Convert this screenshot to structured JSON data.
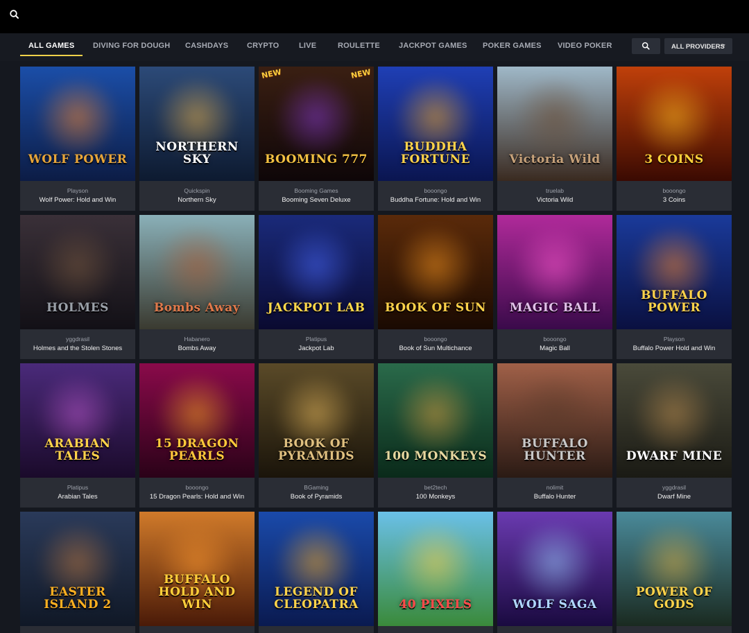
{
  "nav": {
    "tabs": [
      {
        "label": "ALL GAMES"
      },
      {
        "label": "DIVING FOR DOUGH"
      },
      {
        "label": "CASHDAYS"
      },
      {
        "label": "CRYPTO"
      },
      {
        "label": "LIVE"
      },
      {
        "label": "ROULETTE"
      },
      {
        "label": "JACKPOT GAMES"
      },
      {
        "label": "POKER GAMES"
      },
      {
        "label": "VIDEO POKER"
      }
    ],
    "active_tab": "ALL GAMES",
    "providers_label": "ALL PROVIDERS"
  },
  "colors": {
    "accent": "#f0d24a",
    "card_bg": "#2a2d35",
    "page_bg": "#15181f"
  },
  "games": [
    {
      "provider": "Playson",
      "name": "Wolf Power: Hold and Win",
      "art": "WOLF POWER",
      "art_color": "#e8a63a",
      "bg": [
        "#1b4ea8",
        "#0c1c45"
      ],
      "glow": "#ff8a2a"
    },
    {
      "provider": "Quickspin",
      "name": "Northern Sky",
      "art": "NORTHERN SKY",
      "art_color": "#ffffff",
      "bg": [
        "#2c4a78",
        "#0d1a30"
      ],
      "glow": "#f0b64a"
    },
    {
      "provider": "Booming Games",
      "name": "Booming Seven Deluxe",
      "art": "BOOMING 777",
      "art_color": "#f5c242",
      "bg": [
        "#3a1f12",
        "#0e0608"
      ],
      "glow": "#8a3cd8",
      "new": "NEW"
    },
    {
      "provider": "booongo",
      "name": "Buddha Fortune: Hold and Win",
      "art": "BUDDHA FORTUNE",
      "art_color": "#ffd34a",
      "bg": [
        "#1f3fb5",
        "#0a1550"
      ],
      "glow": "#ffb020"
    },
    {
      "provider": "truelab",
      "name": "Victoria Wild",
      "art": "Victoria Wild",
      "art_color": "#c7a27a",
      "bg": [
        "#9fb8c8",
        "#3a2a20"
      ],
      "glow": "#6a4a30"
    },
    {
      "provider": "booongo",
      "name": "3 Coins",
      "art": "3 COINS",
      "art_color": "#ffd23a",
      "bg": [
        "#c0400a",
        "#3a0a02"
      ],
      "glow": "#ffc020"
    },
    {
      "provider": "yggdrasil",
      "name": "Holmes and the Stolen Stones",
      "art": "HOLMES",
      "art_color": "#9aa0a8",
      "bg": [
        "#3a3038",
        "#121016"
      ],
      "glow": "#7a5a40"
    },
    {
      "provider": "Habanero",
      "name": "Bombs Away",
      "art": "Bombs Away",
      "art_color": "#e0784a",
      "bg": [
        "#8ab0b8",
        "#3a3a30"
      ],
      "glow": "#b05a30"
    },
    {
      "provider": "Platipus",
      "name": "Jackpot Lab",
      "art": "JACKPOT LAB",
      "art_color": "#ffd94a",
      "bg": [
        "#1a2a7a",
        "#0a0a30"
      ],
      "glow": "#4a6aff"
    },
    {
      "provider": "booongo",
      "name": "Book of Sun Multichance",
      "art": "BOOK OF SUN",
      "art_color": "#ffd34a",
      "bg": [
        "#5a2a0a",
        "#1a0a02"
      ],
      "glow": "#ff9a20"
    },
    {
      "provider": "booongo",
      "name": "Magic Ball",
      "art": "MAGIC BALL",
      "art_color": "#e0c0e8",
      "bg": [
        "#b02a9a",
        "#3a0a4a"
      ],
      "glow": "#ff5ad0"
    },
    {
      "provider": "Playson",
      "name": "Buffalo Power Hold and Win",
      "art": "BUFFALO POWER",
      "art_color": "#ffd34a",
      "bg": [
        "#1a3a9a",
        "#0a1040"
      ],
      "glow": "#ff8a2a"
    },
    {
      "provider": "Platipus",
      "name": "Arabian Tales",
      "art": "ARABIAN TALES",
      "art_color": "#ffd34a",
      "bg": [
        "#4a2a7a",
        "#1a0a2a"
      ],
      "glow": "#c05ad0"
    },
    {
      "provider": "booongo",
      "name": "15 Dragon Pearls: Hold and Win",
      "art": "15 DRAGON PEARLS",
      "art_color": "#ffc83a",
      "bg": [
        "#8a0a4a",
        "#2a0218"
      ],
      "glow": "#ffaa20"
    },
    {
      "provider": "BGaming",
      "name": "Book of Pyramids",
      "art": "BOOK OF PYRAMIDS",
      "art_color": "#e0c080",
      "bg": [
        "#5a4a28",
        "#1a140a"
      ],
      "glow": "#f0c060"
    },
    {
      "provider": "bet2tech",
      "name": "100 Monkeys",
      "art": "100 MONKEYS",
      "art_color": "#e8d8a0",
      "bg": [
        "#2a6a4a",
        "#0a2a1a"
      ],
      "glow": "#e0a040"
    },
    {
      "provider": "nolimit",
      "name": "Buffalo Hunter",
      "art": "BUFFALO HUNTER",
      "art_color": "#c8c8c8",
      "bg": [
        "#a06048",
        "#2a1a14"
      ],
      "glow": "#5a3a2a"
    },
    {
      "provider": "yggdrasil",
      "name": "Dwarf Mine",
      "art": "DWARF MINE",
      "art_color": "#ffffff",
      "bg": [
        "#4a4a3a",
        "#1a1a14"
      ],
      "glow": "#c09050"
    },
    {
      "provider": "",
      "name": "",
      "art": "EASTER ISLAND 2",
      "art_color": "#ffb020",
      "bg": [
        "#2a3a5a",
        "#101826"
      ],
      "glow": "#c07a40"
    },
    {
      "provider": "",
      "name": "",
      "art": "BUFFALO HOLD AND WIN",
      "art_color": "#ffcf3a",
      "bg": [
        "#d07a2a",
        "#4a1a08"
      ],
      "glow": "#ff9a30"
    },
    {
      "provider": "",
      "name": "",
      "art": "LEGEND OF CLEOPATRA",
      "art_color": "#ffd34a",
      "bg": [
        "#1a4aaa",
        "#0a1a50"
      ],
      "glow": "#ffb020"
    },
    {
      "provider": "",
      "name": "",
      "art": "40 PIXELS",
      "art_color": "#ff4a4a",
      "bg": [
        "#6ac0e8",
        "#3a8a3a"
      ],
      "glow": "#ffd040"
    },
    {
      "provider": "",
      "name": "",
      "art": "WOLF SAGA",
      "art_color": "#b0d8ff",
      "bg": [
        "#6a3ab0",
        "#1a0a40"
      ],
      "glow": "#9ad0ff"
    },
    {
      "provider": "",
      "name": "",
      "art": "POWER OF GODS",
      "art_color": "#ffd34a",
      "bg": [
        "#4a8a9a",
        "#1a2a20"
      ],
      "glow": "#e0b040"
    }
  ]
}
